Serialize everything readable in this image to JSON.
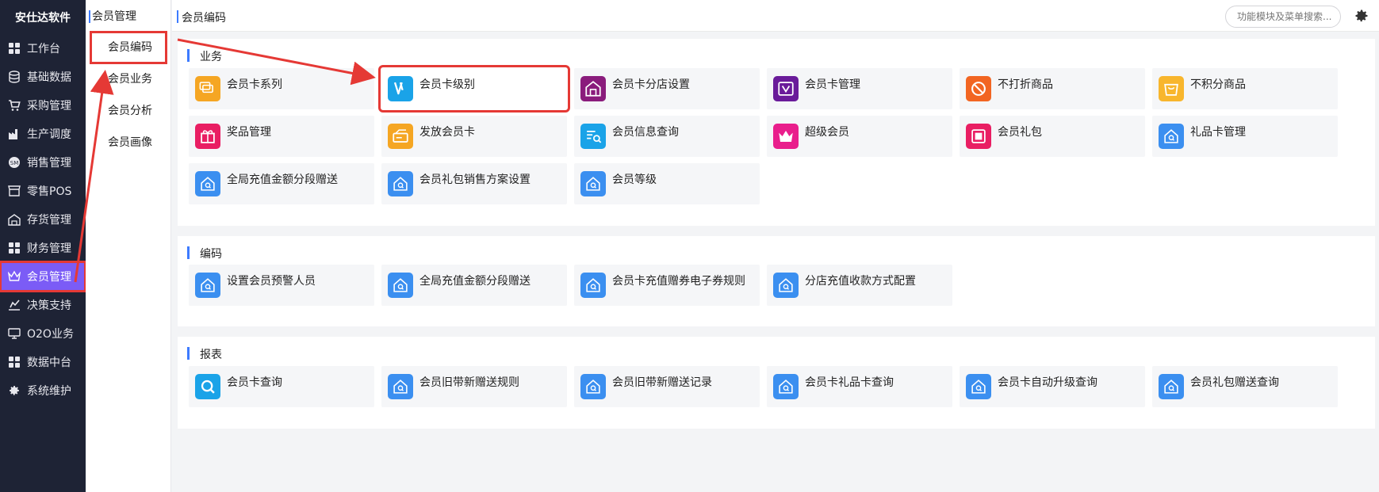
{
  "brand": "安仕达软件",
  "nav": [
    {
      "label": "工作台",
      "icon": "grid-icon"
    },
    {
      "label": "基础数据",
      "icon": "database-icon"
    },
    {
      "label": "采购管理",
      "icon": "cart-icon"
    },
    {
      "label": "生产调度",
      "icon": "factory-icon"
    },
    {
      "label": "销售管理",
      "icon": "sales-icon"
    },
    {
      "label": "零售POS",
      "icon": "store-icon"
    },
    {
      "label": "存货管理",
      "icon": "warehouse-icon"
    },
    {
      "label": "财务管理",
      "icon": "grid-icon"
    },
    {
      "label": "会员管理",
      "icon": "crown-icon"
    },
    {
      "label": "决策支持",
      "icon": "chart-icon"
    },
    {
      "label": "O2O业务",
      "icon": "monitor-icon"
    },
    {
      "label": "数据中台",
      "icon": "grid-icon"
    },
    {
      "label": "系统维护",
      "icon": "gear-icon"
    }
  ],
  "submenu": {
    "title": "会员管理",
    "items": [
      "会员编码",
      "会员业务",
      "会员分析",
      "会员画像"
    ]
  },
  "topbar": {
    "breadcrumb": "会员编码",
    "search_placeholder": "功能模块及菜单搜索..."
  },
  "sections": [
    {
      "title": "业务",
      "items": [
        {
          "label": "会员卡系列",
          "icon": "card-series-icon",
          "color": "#f5a623"
        },
        {
          "label": "会员卡级别",
          "icon": "v-level-icon",
          "color": "#1aa3e8"
        },
        {
          "label": "会员卡分店设置",
          "icon": "store-house-icon",
          "color": "#8a1c7c"
        },
        {
          "label": "会员卡管理",
          "icon": "card-manage-icon",
          "color": "#6a1b9a"
        },
        {
          "label": "不打折商品",
          "icon": "no-discount-icon",
          "color": "#f26522"
        },
        {
          "label": "不积分商品",
          "icon": "bag-icon",
          "color": "#f8b62d"
        },
        {
          "label": "奖品管理",
          "icon": "gift-icon",
          "color": "#e91e63"
        },
        {
          "label": "发放会员卡",
          "icon": "issue-card-icon",
          "color": "#f5a623"
        },
        {
          "label": "会员信息查询",
          "icon": "info-search-icon",
          "color": "#1aa3e8"
        },
        {
          "label": "超级会员",
          "icon": "crown-icon",
          "color": "#e91e8c"
        },
        {
          "label": "会员礼包",
          "icon": "gift-pack-icon",
          "color": "#e91e63"
        },
        {
          "label": "礼品卡管理",
          "icon": "house-search-icon",
          "color": "#3b8ff0"
        },
        {
          "label": "全局充值金额分段赠送",
          "icon": "house-search-icon",
          "color": "#3b8ff0"
        },
        {
          "label": "会员礼包销售方案设置",
          "icon": "house-search-icon",
          "color": "#3b8ff0"
        },
        {
          "label": "会员等级",
          "icon": "house-search-icon",
          "color": "#3b8ff0"
        }
      ]
    },
    {
      "title": "编码",
      "items": [
        {
          "label": "设置会员预警人员",
          "icon": "house-search-icon",
          "color": "#3b8ff0"
        },
        {
          "label": "全局充值金额分段赠送",
          "icon": "house-search-icon",
          "color": "#3b8ff0"
        },
        {
          "label": "会员卡充值赠券电子券规则",
          "icon": "house-search-icon",
          "color": "#3b8ff0"
        },
        {
          "label": "分店充值收款方式配置",
          "icon": "house-search-icon",
          "color": "#3b8ff0"
        }
      ]
    },
    {
      "title": "报表",
      "items": [
        {
          "label": "会员卡查询",
          "icon": "magnifier-icon",
          "color": "#1aa3e8"
        },
        {
          "label": "会员旧带新赠送规则",
          "icon": "house-search-icon",
          "color": "#3b8ff0"
        },
        {
          "label": "会员旧带新赠送记录",
          "icon": "house-search-icon",
          "color": "#3b8ff0"
        },
        {
          "label": "会员卡礼品卡查询",
          "icon": "house-search-icon",
          "color": "#3b8ff0"
        },
        {
          "label": "会员卡自动升级查询",
          "icon": "house-search-icon",
          "color": "#3b8ff0"
        },
        {
          "label": "会员礼包赠送查询",
          "icon": "house-search-icon",
          "color": "#3b8ff0"
        }
      ]
    }
  ],
  "colors": {
    "sidebar_bg": "#1e2335",
    "active_nav": "#7b5cf6",
    "accent": "#3d7bff",
    "highlight_red": "#e53935"
  }
}
